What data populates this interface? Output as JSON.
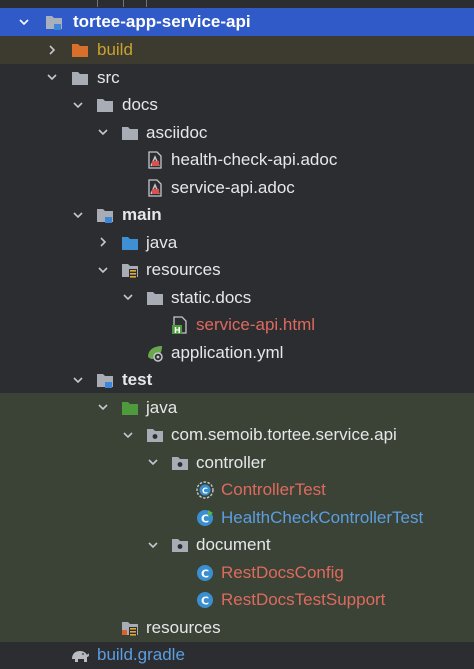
{
  "project": {
    "name": "tortee-app-service-api"
  },
  "tree": {
    "build": "build",
    "src": "src",
    "docs": "docs",
    "asciidoc": "asciidoc",
    "health_check_adoc": "health-check-api.adoc",
    "service_api_adoc": "service-api.adoc",
    "main": "main",
    "java": "java",
    "resources": "resources",
    "static_docs": "static.docs",
    "service_api_html": "service-api.html",
    "application_yml": "application.yml",
    "test": "test",
    "test_java": "java",
    "package": "com.semoib.tortee.service.api",
    "controller": "controller",
    "controller_test": "ControllerTest",
    "health_check_controller_test": "HealthCheckControllerTest",
    "document": "document",
    "rest_docs_config": "RestDocsConfig",
    "rest_docs_test_support": "RestDocsTestSupport",
    "test_resources": "resources",
    "build_gradle": "build.gradle"
  },
  "colors": {
    "background": "#2b2d30",
    "selection": "#2f5ac7",
    "build_band": "#3d3b2f",
    "test_band": "#33402f",
    "excluded_yellow": "#c9a332",
    "modified_red": "#de6a5e",
    "modified_blue": "#5c9ee0"
  }
}
